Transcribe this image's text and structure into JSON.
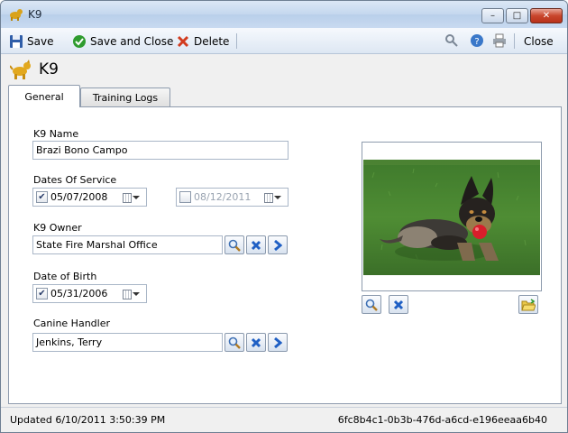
{
  "window": {
    "title": "K9",
    "buttons": {
      "minimize": "–",
      "maximize": "□",
      "close": "✕"
    }
  },
  "toolbar": {
    "save_label": "Save",
    "save_close_label": "Save and Close",
    "delete_label": "Delete",
    "close_label": "Close"
  },
  "header": {
    "title": "K9"
  },
  "tabs": [
    {
      "label": "General",
      "active": true
    },
    {
      "label": "Training Logs",
      "active": false
    }
  ],
  "form": {
    "k9_name": {
      "label": "K9 Name",
      "value": "Brazi Bono Campo"
    },
    "dates_of_service": {
      "label": "Dates Of Service",
      "start": {
        "value": "05/07/2008",
        "checked": true
      },
      "end": {
        "value": "08/12/2011",
        "checked": false
      }
    },
    "k9_owner": {
      "label": "K9 Owner",
      "value": "State Fire Marshal Office"
    },
    "date_of_birth": {
      "label": "Date of Birth",
      "value": "05/31/2006",
      "checked": true
    },
    "canine_handler": {
      "label": "Canine Handler",
      "value": "Jenkins, Terry"
    }
  },
  "status": {
    "updated": "Updated 6/10/2011 3:50:39 PM",
    "record_id": "6fc8b4c1-0b3b-476d-a6cd-e196eeaa6b40"
  },
  "colors": {
    "titlebar": "#c4d7ee",
    "accent_blue": "#1f5fc4",
    "delete_red": "#d23b1e",
    "save_green": "#2e9b2e"
  }
}
